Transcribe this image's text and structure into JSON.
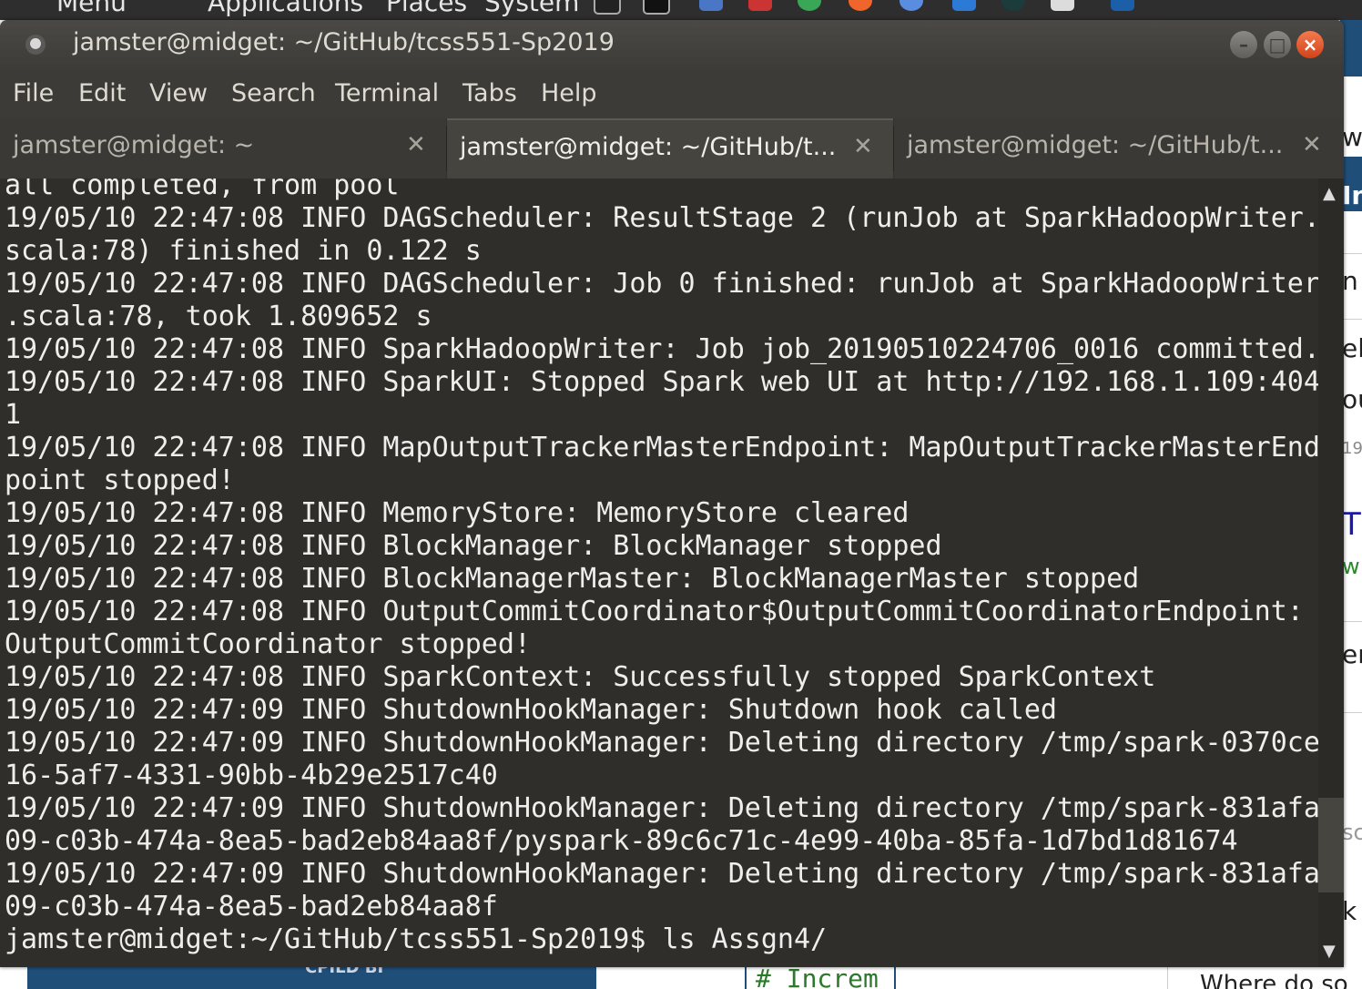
{
  "top_panel": {
    "menu_label": "Menu",
    "applications_label": "Applications",
    "places_label": "Places",
    "system_label": "System",
    "tray_icons": [
      "terminal-icon",
      "terminal-icon",
      "file-manager-icon",
      "pdf-icon",
      "chrome-icon",
      "firefox-icon",
      "browser-icon",
      "messages-icon",
      "github-icon",
      "disk-icon",
      "vscode-icon"
    ]
  },
  "window": {
    "title": "jamster@midget: ~/GitHub/tcss551-Sp2019",
    "minimize_glyph": "–",
    "maximize_glyph": "□",
    "close_glyph": "×"
  },
  "menubar": {
    "items": [
      "File",
      "Edit",
      "View",
      "Search",
      "Terminal",
      "Tabs",
      "Help"
    ]
  },
  "tabs": [
    {
      "label": "jamster@midget: ~",
      "close": "✕",
      "active": false
    },
    {
      "label": "jamster@midget: ~/GitHub/t...",
      "close": "✕",
      "active": true
    },
    {
      "label": "jamster@midget: ~/GitHub/t...",
      "close": "✕",
      "active": false
    }
  ],
  "terminal": {
    "lines": [
      "all completed, from pool",
      "19/05/10 22:47:08 INFO DAGScheduler: ResultStage 2 (runJob at SparkHadoopWriter.",
      "scala:78) finished in 0.122 s",
      "19/05/10 22:47:08 INFO DAGScheduler: Job 0 finished: runJob at SparkHadoopWriter",
      ".scala:78, took 1.809652 s",
      "19/05/10 22:47:08 INFO SparkHadoopWriter: Job job_20190510224706_0016 committed.",
      "19/05/10 22:47:08 INFO SparkUI: Stopped Spark web UI at http://192.168.1.109:404",
      "1",
      "19/05/10 22:47:08 INFO MapOutputTrackerMasterEndpoint: MapOutputTrackerMasterEnd",
      "point stopped!",
      "19/05/10 22:47:08 INFO MemoryStore: MemoryStore cleared",
      "19/05/10 22:47:08 INFO BlockManager: BlockManager stopped",
      "19/05/10 22:47:08 INFO BlockManagerMaster: BlockManagerMaster stopped",
      "19/05/10 22:47:08 INFO OutputCommitCoordinator$OutputCommitCoordinatorEndpoint:",
      "OutputCommitCoordinator stopped!",
      "19/05/10 22:47:08 INFO SparkContext: Successfully stopped SparkContext",
      "19/05/10 22:47:09 INFO ShutdownHookManager: Shutdown hook called",
      "19/05/10 22:47:09 INFO ShutdownHookManager: Deleting directory /tmp/spark-0370ce",
      "16-5af7-4331-90bb-4b29e2517c40",
      "19/05/10 22:47:09 INFO ShutdownHookManager: Deleting directory /tmp/spark-831afa",
      "09-c03b-474a-8ea5-bad2eb84aa8f/pyspark-89c6c71c-4e99-40ba-85fa-1d7bd1d81674",
      "19/05/10 22:47:09 INFO ShutdownHookManager: Deleting directory /tmp/spark-831afa",
      "09-c03b-474a-8ea5-bad2eb84aa8f",
      "jamster@midget:~/GitHub/tcss551-Sp2019$ ls Assgn4/"
    ],
    "scroll_up_glyph": "▲",
    "scroll_down_glyph": "▼"
  },
  "background_window": {
    "fragments": [
      "w.",
      "In",
      "n",
      "ela",
      "ou",
      "19",
      "T",
      "w",
      "en",
      "sc",
      "k"
    ]
  },
  "background_bottom": {
    "blue_block_text": "CPILD BI",
    "code_fragment": "# Increm",
    "right_fragment": "Where do so"
  },
  "colors": {
    "terminal_bg": "#2f2e2b",
    "terminal_fg": "#eeeeec",
    "close_button": "#e2572b",
    "titlebar": "#3c3b37"
  }
}
